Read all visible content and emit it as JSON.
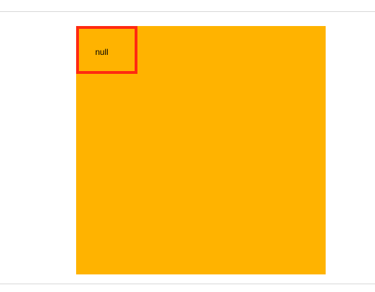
{
  "element": {
    "label": "null"
  },
  "colors": {
    "background": "#ffffff",
    "divider": "#d8d8d8",
    "panel": "#ffb300",
    "highlight_border": "#ff2a10",
    "text": "#000000"
  }
}
